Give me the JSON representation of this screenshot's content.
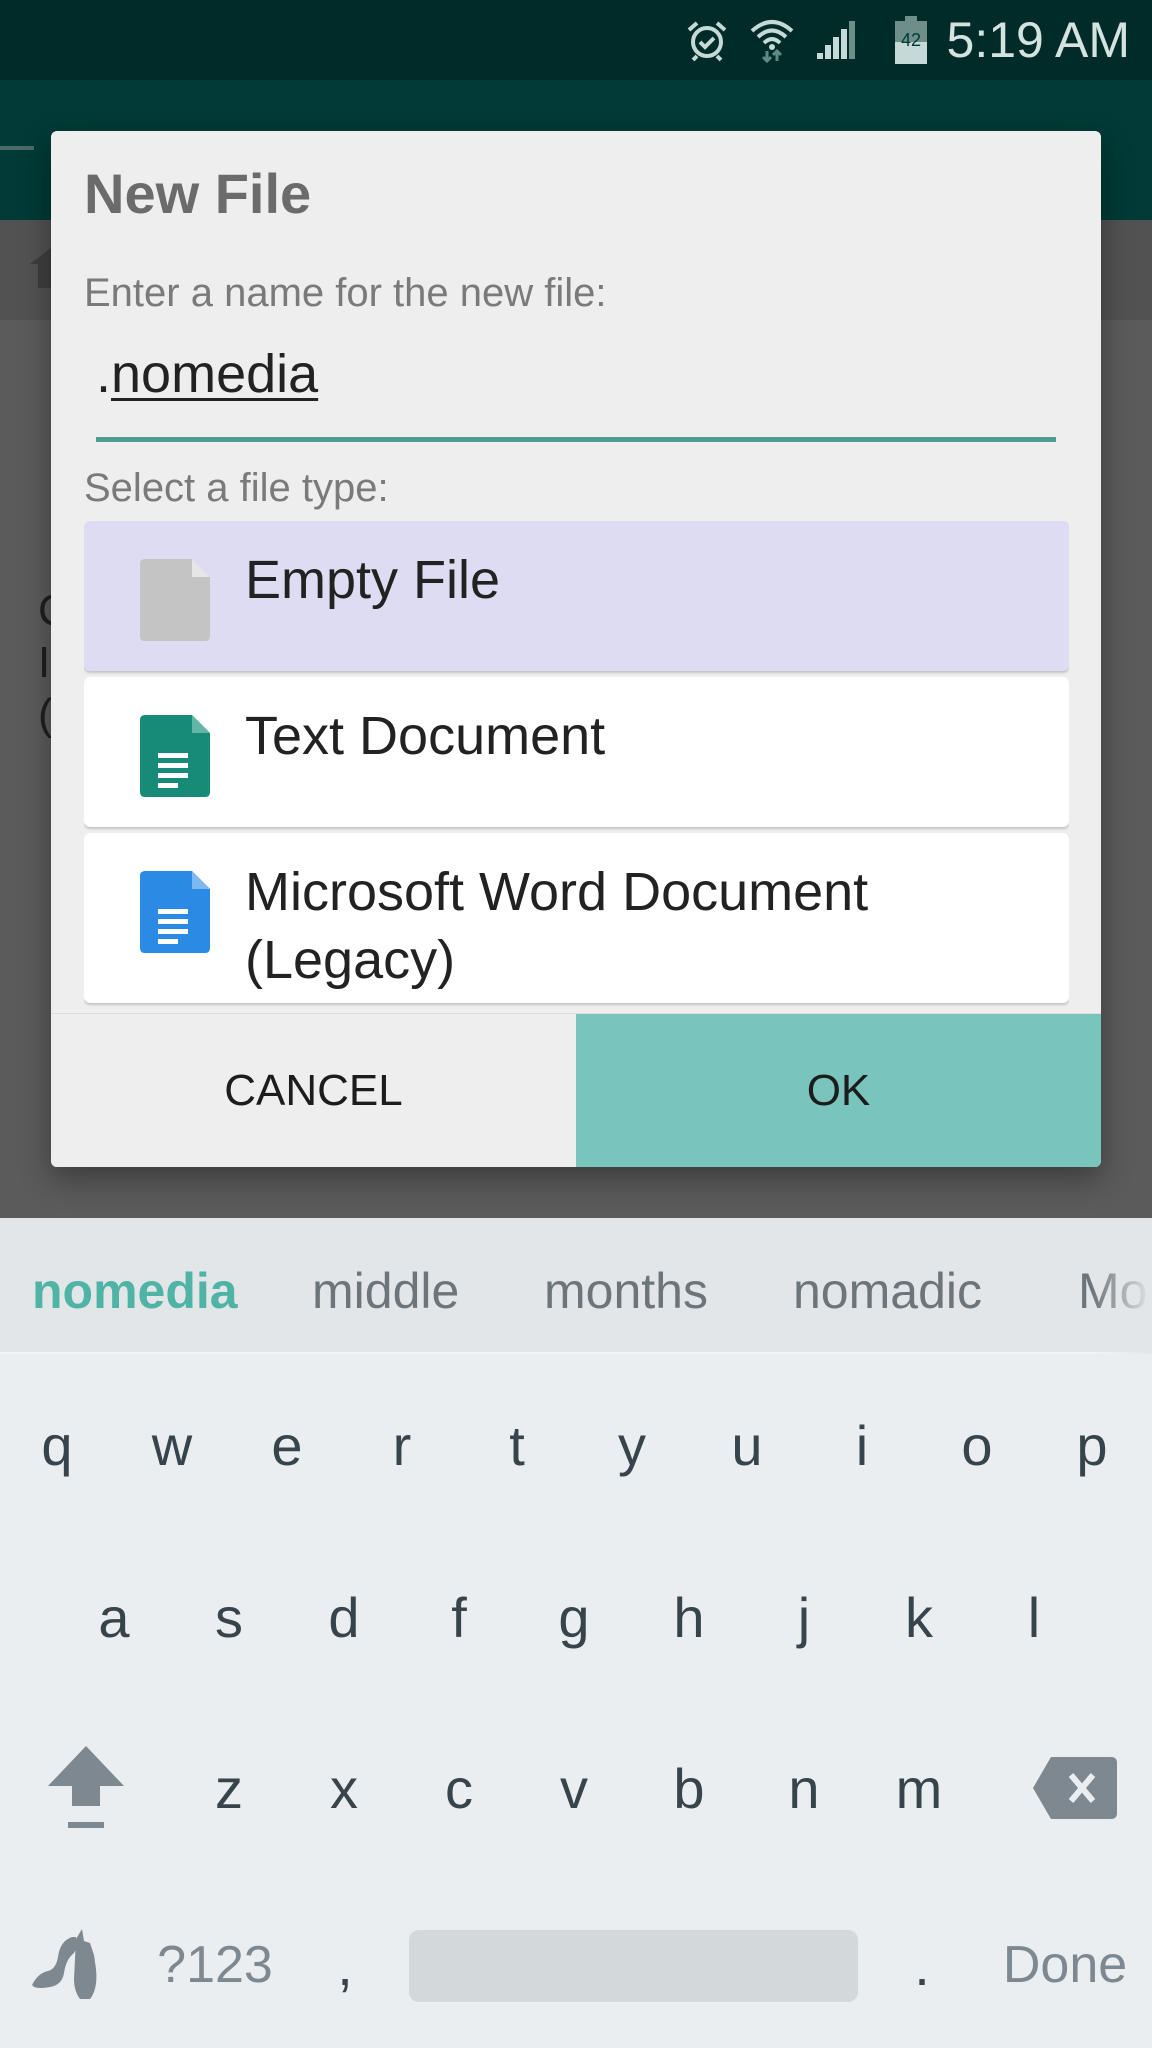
{
  "status_bar": {
    "time": "5:19 AM",
    "battery_level": "42",
    "icons": [
      "alarm-icon",
      "wifi-icon",
      "signal-icon",
      "battery-icon"
    ]
  },
  "background": {
    "partial_text": [
      "C",
      "I",
      "("
    ]
  },
  "dialog": {
    "title": "New File",
    "name_label": "Enter a name for the new file:",
    "name_value_prefix": ".",
    "name_value_main": "nomedia",
    "type_label": "Select a file type:",
    "file_types": [
      {
        "label": "Empty File",
        "icon": "blank-file-icon",
        "selected": true,
        "color": "#c4c4c4"
      },
      {
        "label": "Text Document",
        "icon": "text-document-icon",
        "selected": false,
        "color": "#188a78"
      },
      {
        "label": "Microsoft Word Document (Legacy)",
        "icon": "word-document-icon",
        "selected": false,
        "color": "#2a8ae4"
      }
    ],
    "cancel_label": "CANCEL",
    "ok_label": "OK",
    "accent_color": "#79c4bd"
  },
  "keyboard": {
    "suggestions": [
      "nomedia",
      "middle",
      "months",
      "nomadic",
      "Mo"
    ],
    "row1": [
      "q",
      "w",
      "e",
      "r",
      "t",
      "y",
      "u",
      "i",
      "o",
      "p"
    ],
    "row2": [
      "a",
      "s",
      "d",
      "f",
      "g",
      "h",
      "j",
      "k",
      "l"
    ],
    "row3": [
      "z",
      "x",
      "c",
      "v",
      "b",
      "n",
      "m"
    ],
    "symbols_label": "?123",
    "comma": ",",
    "period": ".",
    "done_label": "Done"
  }
}
